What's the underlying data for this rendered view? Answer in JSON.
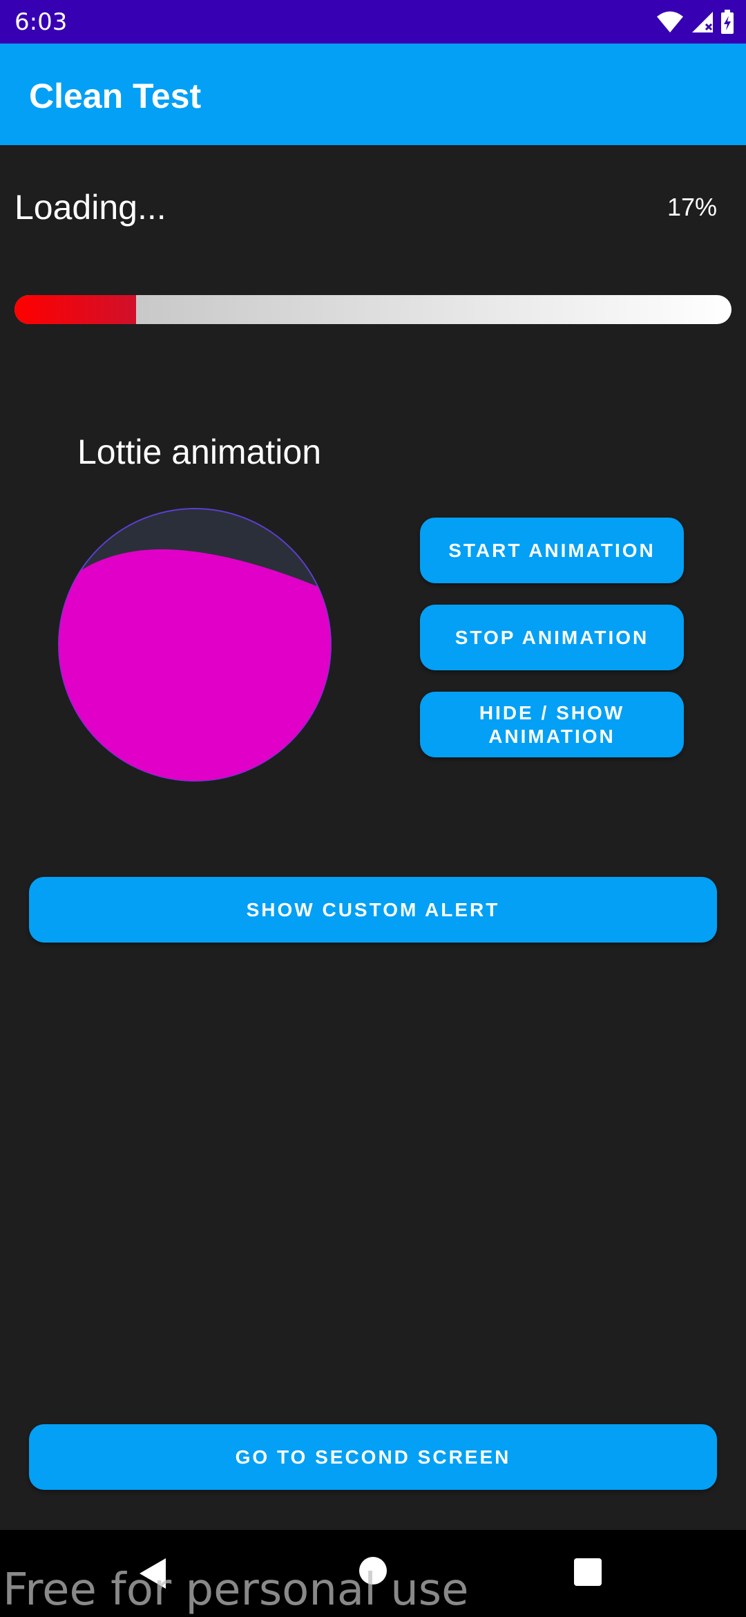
{
  "status_bar": {
    "time": "6:03",
    "icons": [
      "wifi-icon",
      "cell-signal-icon",
      "battery-charging-icon"
    ]
  },
  "app_bar": {
    "title": "Clean Test",
    "color": "#03a0f5"
  },
  "loading": {
    "label": "Loading...",
    "percent_text": "17%",
    "progress": 0.17
  },
  "lottie": {
    "title": "Lottie animation",
    "fill_color": "#e000c8"
  },
  "buttons": {
    "start_animation": "START ANIMATION",
    "stop_animation": "STOP ANIMATION",
    "hide_show_animation": "HIDE / SHOW ANIMATION",
    "show_custom_alert": "SHOW CUSTOM ALERT",
    "go_to_second_screen": "GO TO SECOND SCREEN"
  },
  "nav_bar": {
    "icons": [
      "back-icon",
      "home-icon",
      "recents-icon"
    ]
  },
  "watermark": "Free for personal use",
  "colors": {
    "status_bar": "#3700b3",
    "background": "#1e1e1e",
    "accent": "#03a0f5"
  }
}
